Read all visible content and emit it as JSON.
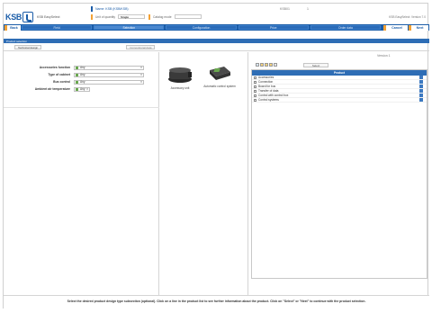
{
  "header": {
    "logo_text": "KSB",
    "app_name": "KSB EasySelect",
    "name_label": "Name: KSB (KSB/KSB)",
    "mid_label": "KSB01",
    "mid_label2": "1",
    "right_label": "Version 1",
    "sub_seg1_label": "Unit of quantity",
    "sub_seg1_value": "Single",
    "sub_seg2_label": "Catalog mode",
    "sub_seg2_value": "",
    "hint": "KSB EasySelect: Version 7.0"
  },
  "nav": {
    "back": "Back",
    "tabs": [
      "Field",
      "Selection",
      "Configuration",
      "Price",
      "Order data"
    ],
    "cancel": "Cancel",
    "next": "Next"
  },
  "section_title": "Product selection",
  "toolbar": {
    "btn1": "Technical design",
    "btn2": "Conventional data"
  },
  "criteria": [
    {
      "label": "Accessories function",
      "value": "Any",
      "small": false
    },
    {
      "label": "Type of cabinet",
      "value": "Any",
      "small": false
    },
    {
      "label": "Bus control",
      "value": "Any",
      "small": false
    },
    {
      "label": "Ambient air temperature",
      "value": "Any",
      "small": true
    }
  ],
  "products": [
    {
      "label": "Accessory unit"
    },
    {
      "label": "Automatic control system"
    }
  ],
  "list": {
    "search_button": "Select",
    "header": "Product",
    "items": [
      "Accessories",
      "Connection",
      "Board for bus",
      "Transfer of data",
      "Control with control box",
      "Control systems"
    ]
  },
  "footer_text": "Select the desired product design type subsection (optional). Click on a line in the product list to see further information about the product. Click on \"Select\" or \"Next\" to continue with the product selection.",
  "colors": {
    "brand_blue": "#1a5ca8",
    "accent_orange": "#f3a236",
    "check_green": "#6aa84f"
  }
}
